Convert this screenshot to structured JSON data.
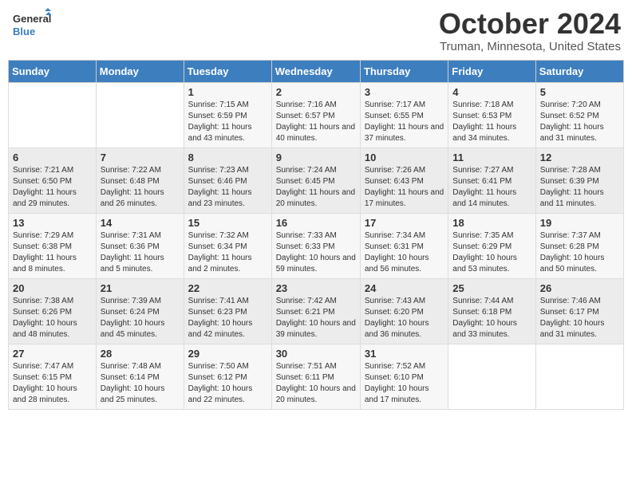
{
  "logo": {
    "line1": "General",
    "line2": "Blue"
  },
  "title": "October 2024",
  "location": "Truman, Minnesota, United States",
  "days_of_week": [
    "Sunday",
    "Monday",
    "Tuesday",
    "Wednesday",
    "Thursday",
    "Friday",
    "Saturday"
  ],
  "weeks": [
    [
      {
        "day": "",
        "sunrise": "",
        "sunset": "",
        "daylight": ""
      },
      {
        "day": "",
        "sunrise": "",
        "sunset": "",
        "daylight": ""
      },
      {
        "day": "1",
        "sunrise": "Sunrise: 7:15 AM",
        "sunset": "Sunset: 6:59 PM",
        "daylight": "Daylight: 11 hours and 43 minutes."
      },
      {
        "day": "2",
        "sunrise": "Sunrise: 7:16 AM",
        "sunset": "Sunset: 6:57 PM",
        "daylight": "Daylight: 11 hours and 40 minutes."
      },
      {
        "day": "3",
        "sunrise": "Sunrise: 7:17 AM",
        "sunset": "Sunset: 6:55 PM",
        "daylight": "Daylight: 11 hours and 37 minutes."
      },
      {
        "day": "4",
        "sunrise": "Sunrise: 7:18 AM",
        "sunset": "Sunset: 6:53 PM",
        "daylight": "Daylight: 11 hours and 34 minutes."
      },
      {
        "day": "5",
        "sunrise": "Sunrise: 7:20 AM",
        "sunset": "Sunset: 6:52 PM",
        "daylight": "Daylight: 11 hours and 31 minutes."
      }
    ],
    [
      {
        "day": "6",
        "sunrise": "Sunrise: 7:21 AM",
        "sunset": "Sunset: 6:50 PM",
        "daylight": "Daylight: 11 hours and 29 minutes."
      },
      {
        "day": "7",
        "sunrise": "Sunrise: 7:22 AM",
        "sunset": "Sunset: 6:48 PM",
        "daylight": "Daylight: 11 hours and 26 minutes."
      },
      {
        "day": "8",
        "sunrise": "Sunrise: 7:23 AM",
        "sunset": "Sunset: 6:46 PM",
        "daylight": "Daylight: 11 hours and 23 minutes."
      },
      {
        "day": "9",
        "sunrise": "Sunrise: 7:24 AM",
        "sunset": "Sunset: 6:45 PM",
        "daylight": "Daylight: 11 hours and 20 minutes."
      },
      {
        "day": "10",
        "sunrise": "Sunrise: 7:26 AM",
        "sunset": "Sunset: 6:43 PM",
        "daylight": "Daylight: 11 hours and 17 minutes."
      },
      {
        "day": "11",
        "sunrise": "Sunrise: 7:27 AM",
        "sunset": "Sunset: 6:41 PM",
        "daylight": "Daylight: 11 hours and 14 minutes."
      },
      {
        "day": "12",
        "sunrise": "Sunrise: 7:28 AM",
        "sunset": "Sunset: 6:39 PM",
        "daylight": "Daylight: 11 hours and 11 minutes."
      }
    ],
    [
      {
        "day": "13",
        "sunrise": "Sunrise: 7:29 AM",
        "sunset": "Sunset: 6:38 PM",
        "daylight": "Daylight: 11 hours and 8 minutes."
      },
      {
        "day": "14",
        "sunrise": "Sunrise: 7:31 AM",
        "sunset": "Sunset: 6:36 PM",
        "daylight": "Daylight: 11 hours and 5 minutes."
      },
      {
        "day": "15",
        "sunrise": "Sunrise: 7:32 AM",
        "sunset": "Sunset: 6:34 PM",
        "daylight": "Daylight: 11 hours and 2 minutes."
      },
      {
        "day": "16",
        "sunrise": "Sunrise: 7:33 AM",
        "sunset": "Sunset: 6:33 PM",
        "daylight": "Daylight: 10 hours and 59 minutes."
      },
      {
        "day": "17",
        "sunrise": "Sunrise: 7:34 AM",
        "sunset": "Sunset: 6:31 PM",
        "daylight": "Daylight: 10 hours and 56 minutes."
      },
      {
        "day": "18",
        "sunrise": "Sunrise: 7:35 AM",
        "sunset": "Sunset: 6:29 PM",
        "daylight": "Daylight: 10 hours and 53 minutes."
      },
      {
        "day": "19",
        "sunrise": "Sunrise: 7:37 AM",
        "sunset": "Sunset: 6:28 PM",
        "daylight": "Daylight: 10 hours and 50 minutes."
      }
    ],
    [
      {
        "day": "20",
        "sunrise": "Sunrise: 7:38 AM",
        "sunset": "Sunset: 6:26 PM",
        "daylight": "Daylight: 10 hours and 48 minutes."
      },
      {
        "day": "21",
        "sunrise": "Sunrise: 7:39 AM",
        "sunset": "Sunset: 6:24 PM",
        "daylight": "Daylight: 10 hours and 45 minutes."
      },
      {
        "day": "22",
        "sunrise": "Sunrise: 7:41 AM",
        "sunset": "Sunset: 6:23 PM",
        "daylight": "Daylight: 10 hours and 42 minutes."
      },
      {
        "day": "23",
        "sunrise": "Sunrise: 7:42 AM",
        "sunset": "Sunset: 6:21 PM",
        "daylight": "Daylight: 10 hours and 39 minutes."
      },
      {
        "day": "24",
        "sunrise": "Sunrise: 7:43 AM",
        "sunset": "Sunset: 6:20 PM",
        "daylight": "Daylight: 10 hours and 36 minutes."
      },
      {
        "day": "25",
        "sunrise": "Sunrise: 7:44 AM",
        "sunset": "Sunset: 6:18 PM",
        "daylight": "Daylight: 10 hours and 33 minutes."
      },
      {
        "day": "26",
        "sunrise": "Sunrise: 7:46 AM",
        "sunset": "Sunset: 6:17 PM",
        "daylight": "Daylight: 10 hours and 31 minutes."
      }
    ],
    [
      {
        "day": "27",
        "sunrise": "Sunrise: 7:47 AM",
        "sunset": "Sunset: 6:15 PM",
        "daylight": "Daylight: 10 hours and 28 minutes."
      },
      {
        "day": "28",
        "sunrise": "Sunrise: 7:48 AM",
        "sunset": "Sunset: 6:14 PM",
        "daylight": "Daylight: 10 hours and 25 minutes."
      },
      {
        "day": "29",
        "sunrise": "Sunrise: 7:50 AM",
        "sunset": "Sunset: 6:12 PM",
        "daylight": "Daylight: 10 hours and 22 minutes."
      },
      {
        "day": "30",
        "sunrise": "Sunrise: 7:51 AM",
        "sunset": "Sunset: 6:11 PM",
        "daylight": "Daylight: 10 hours and 20 minutes."
      },
      {
        "day": "31",
        "sunrise": "Sunrise: 7:52 AM",
        "sunset": "Sunset: 6:10 PM",
        "daylight": "Daylight: 10 hours and 17 minutes."
      },
      {
        "day": "",
        "sunrise": "",
        "sunset": "",
        "daylight": ""
      },
      {
        "day": "",
        "sunrise": "",
        "sunset": "",
        "daylight": ""
      }
    ]
  ]
}
